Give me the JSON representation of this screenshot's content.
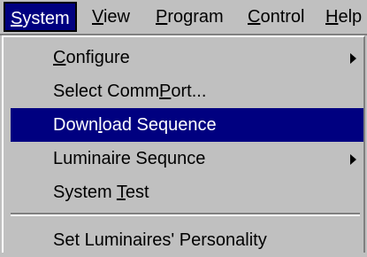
{
  "menubar": {
    "items": [
      {
        "pre": "",
        "u": "S",
        "post": "ystem"
      },
      {
        "pre": "",
        "u": "V",
        "post": "iew"
      },
      {
        "pre": "",
        "u": "P",
        "post": "rogram"
      },
      {
        "pre": "",
        "u": "C",
        "post": "ontrol"
      },
      {
        "pre": "",
        "u": "H",
        "post": "elp"
      }
    ]
  },
  "system_menu": {
    "configure": {
      "pre": "",
      "u": "C",
      "post": "onfigure"
    },
    "select_commport": {
      "pre": "Select Comm",
      "u": "P",
      "post": "ort..."
    },
    "download_sequence": {
      "pre": "Down",
      "u": "l",
      "post": "oad Sequence"
    },
    "luminaire_sequence": {
      "pre": "Luminaire Sequnce",
      "u": "",
      "post": ""
    },
    "system_test": {
      "pre": "System ",
      "u": "T",
      "post": "est"
    },
    "set_personality": {
      "pre": "Set Luminaires' Personality",
      "u": "",
      "post": ""
    }
  },
  "colors": {
    "menu_bg": "#c0c0c0",
    "highlight": "#000080",
    "highlight_text": "#ffffff"
  },
  "icons": [
    "submenu-arrow-icon",
    "submenu-arrow-icon"
  ]
}
